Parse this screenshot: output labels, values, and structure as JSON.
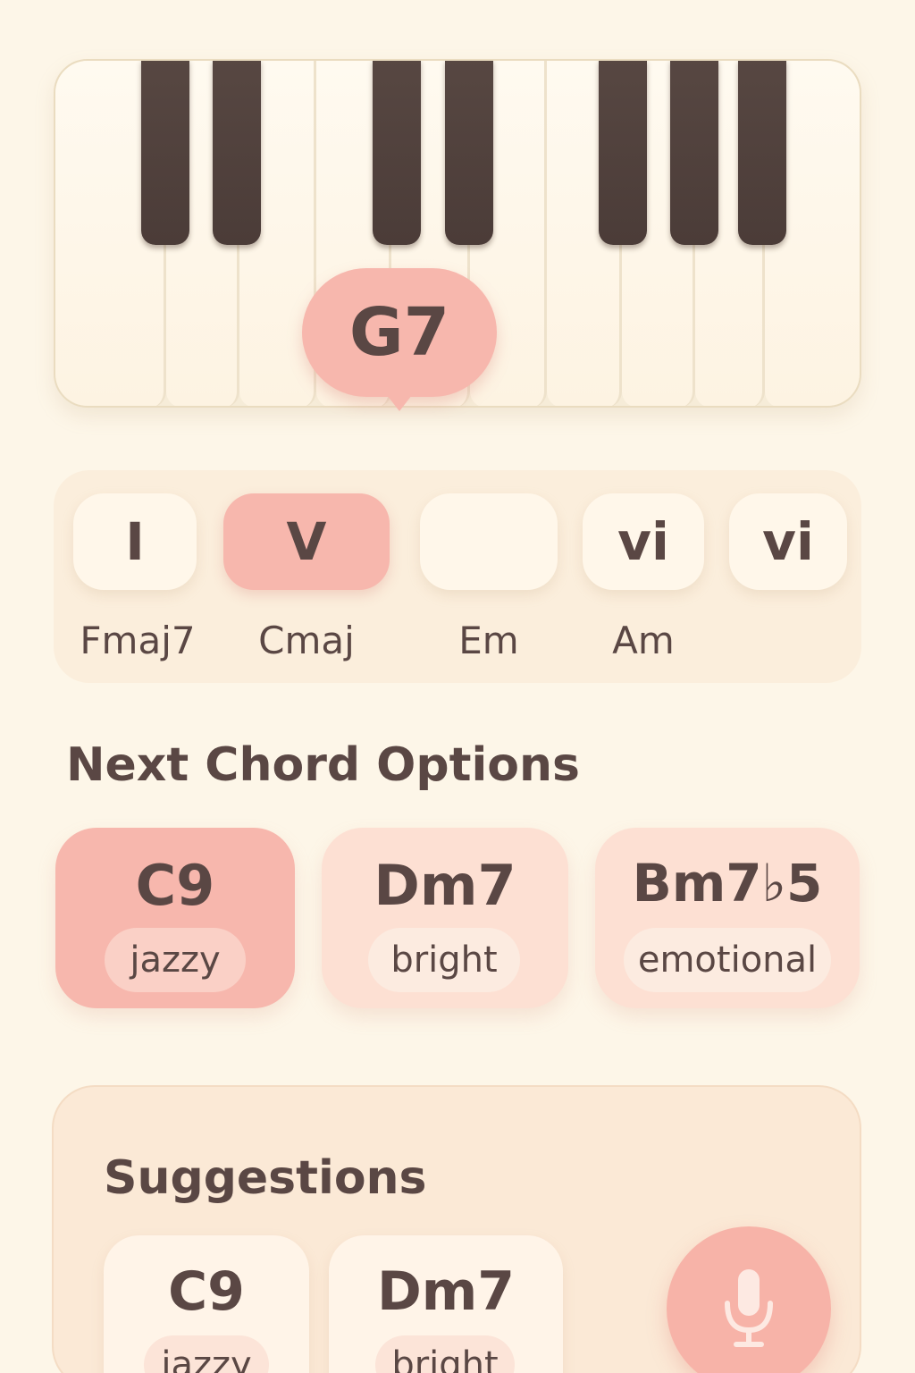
{
  "piano": {
    "current_chord": "G7"
  },
  "progression": {
    "numerals": [
      {
        "numeral": "I",
        "chord": "Fmaj7",
        "active": false
      },
      {
        "numeral": "V",
        "chord": "Cmaj",
        "active": true
      },
      {
        "numeral": "",
        "chord": "Em",
        "active": false
      },
      {
        "numeral": "vi",
        "chord": "Am",
        "active": false
      },
      {
        "numeral": "vi",
        "chord": "",
        "active": false
      }
    ]
  },
  "next_options": {
    "title": "Next Chord Options",
    "options": [
      {
        "chord": "C9",
        "tag": "jazzy",
        "active": true
      },
      {
        "chord": "Dm7",
        "tag": "bright",
        "active": false
      },
      {
        "chord": "Bm7♭5",
        "tag": "emotional",
        "active": false
      }
    ]
  },
  "suggestions": {
    "title": "Suggestions",
    "items": [
      {
        "chord": "C9",
        "tag": "jazzy"
      },
      {
        "chord": "Dm7",
        "tag": "bright"
      }
    ],
    "mic_icon": "microphone-icon"
  },
  "colors": {
    "background": "#fdf6e8",
    "accent": "#f7b7ad",
    "text": "#5a4744",
    "black_key": "#4e3f3b"
  }
}
